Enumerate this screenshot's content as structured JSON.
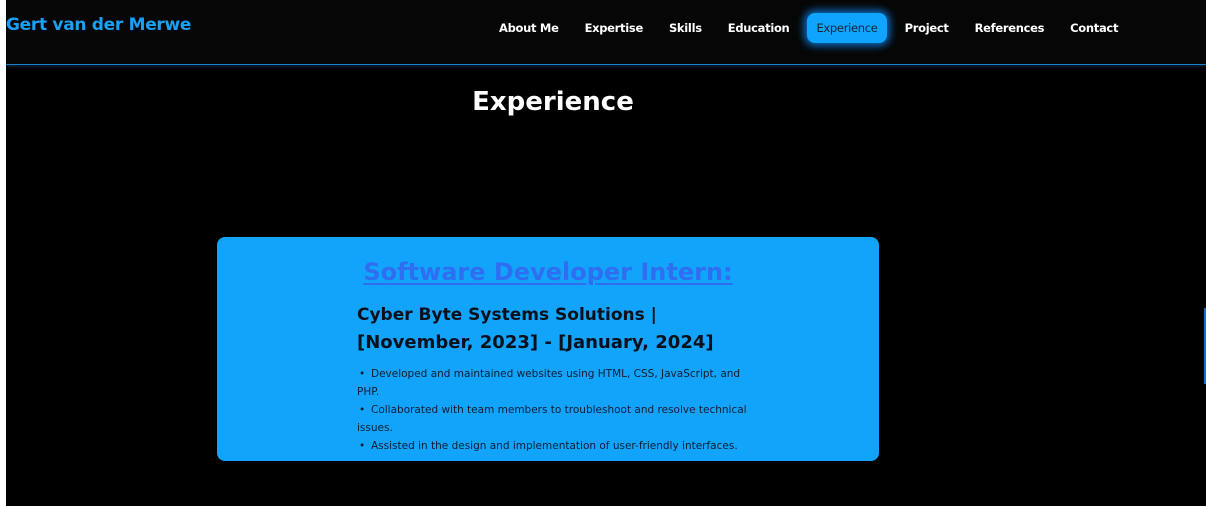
{
  "header": {
    "brand": "Gert van der Merwe",
    "nav": [
      {
        "label": "About Me",
        "active": false
      },
      {
        "label": "Expertise",
        "active": false
      },
      {
        "label": "Skills",
        "active": false
      },
      {
        "label": "Education",
        "active": false
      },
      {
        "label": "Experience",
        "active": true
      },
      {
        "label": "Project",
        "active": false
      },
      {
        "label": "References",
        "active": false
      },
      {
        "label": "Contact",
        "active": false
      }
    ]
  },
  "section": {
    "title": "Experience"
  },
  "experience": {
    "job_title": "Software Developer Intern:",
    "company_line": "Cyber Byte Systems Solutions |",
    "dates_line": "[November, 2023] - [January, 2024]",
    "duties": [
      "Developed and maintained websites using HTML, CSS, JavaScript, and PHP.",
      "Collaborated with team members to troubleshoot and resolve technical issues.",
      "Assisted in the design and implementation of user-friendly interfaces."
    ]
  },
  "colors": {
    "accent": "#12a4fb",
    "link": "#2f6ef0",
    "background": "#000000",
    "brand": "#1aa0f2"
  }
}
